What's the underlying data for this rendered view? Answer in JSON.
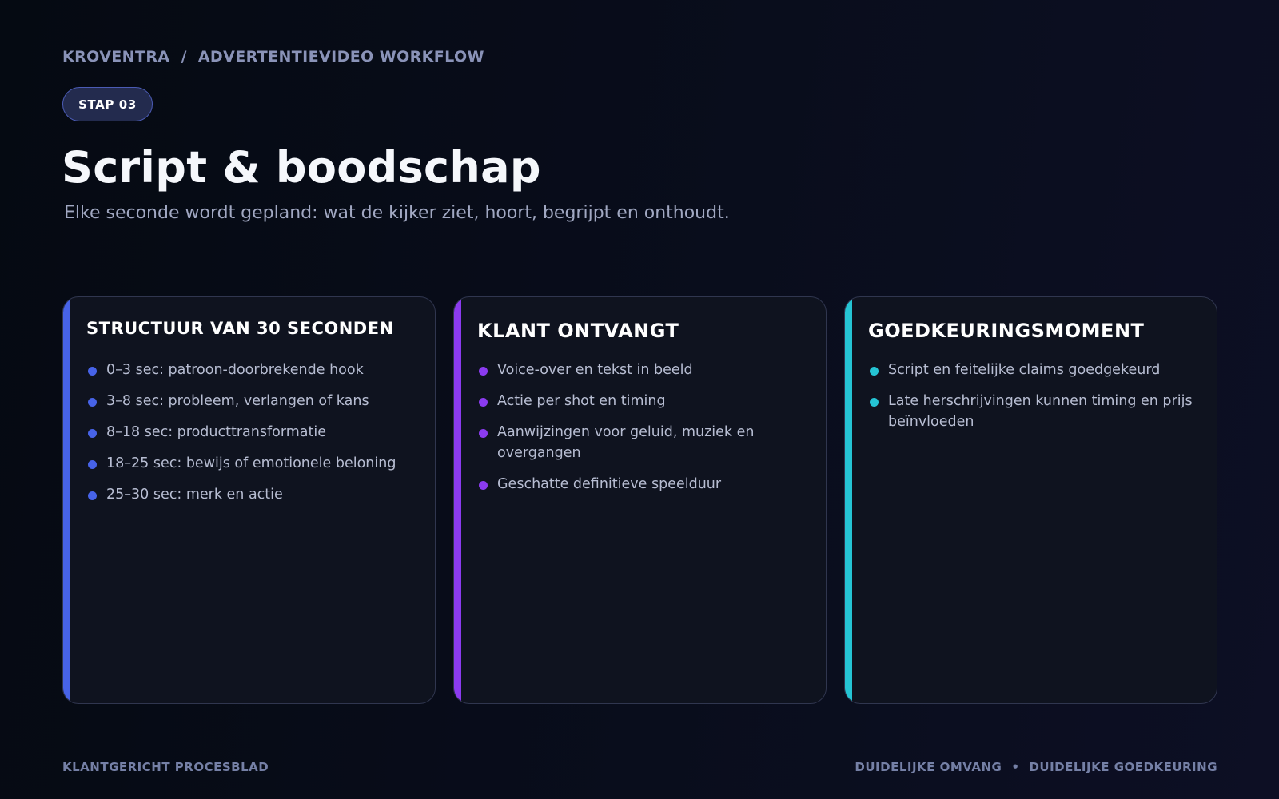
{
  "breadcrumb": {
    "brand": "KROVENTRA",
    "separator": "/",
    "section": "ADVERTENTIEVIDEO WORKFLOW"
  },
  "step_badge": "STAP 03",
  "title": "Script & boodschap",
  "subtitle": "Elke seconde wordt gepland: wat de kijker ziet, hoort, begrijpt en onthoudt.",
  "cards": [
    {
      "heading": "STRUCTUUR VAN 30 SECONDEN",
      "accent": "#4763e8",
      "items": [
        "0–3 sec: patroon-doorbrekende hook",
        "3–8 sec: probleem, verlangen of kans",
        "8–18 sec: producttransformatie",
        "18–25 sec: bewijs of emotionele beloning",
        "25–30 sec: merk en actie"
      ]
    },
    {
      "heading": "KLANT ONTVANGT",
      "accent": "#8b3bf0",
      "items": [
        "Voice-over en tekst in beeld",
        "Actie per shot en timing",
        "Aanwijzingen voor geluid, muziek en overgangen",
        "Geschatte definitieve speelduur"
      ]
    },
    {
      "heading": "GOEDKEURINGSMOMENT",
      "accent": "#25c4d4",
      "items": [
        "Script en feitelijke claims goedgekeurd",
        "Late herschrijvingen kunnen timing en prijs beïnvloeden"
      ]
    }
  ],
  "footer": {
    "left": "KLANTGERICHT PROCESBLAD",
    "right_a": "DUIDELIJKE OMVANG",
    "right_sep": "•",
    "right_b": "DUIDELIJKE GOEDKEURING"
  }
}
